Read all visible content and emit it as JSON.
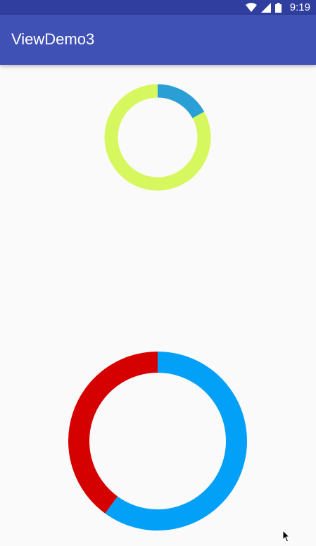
{
  "status_bar": {
    "time": "9:19",
    "icons": [
      "wifi-icon",
      "signal-icon",
      "battery-icon"
    ]
  },
  "app_bar": {
    "title": "ViewDemo3"
  },
  "rings": [
    {
      "name": "small-donut",
      "segments": [
        {
          "fraction": 0.17,
          "color": "#2a9fd6"
        },
        {
          "fraction": 0.83,
          "color": "#d7f75e"
        }
      ]
    },
    {
      "name": "large-donut",
      "segments": [
        {
          "fraction": 0.6,
          "color": "#03a0f7"
        },
        {
          "fraction": 0.4,
          "color": "#d50000"
        }
      ]
    }
  ],
  "colors": {
    "status_bar": "#303f9f",
    "app_bar": "#3f51b5",
    "background": "#fafafa"
  }
}
